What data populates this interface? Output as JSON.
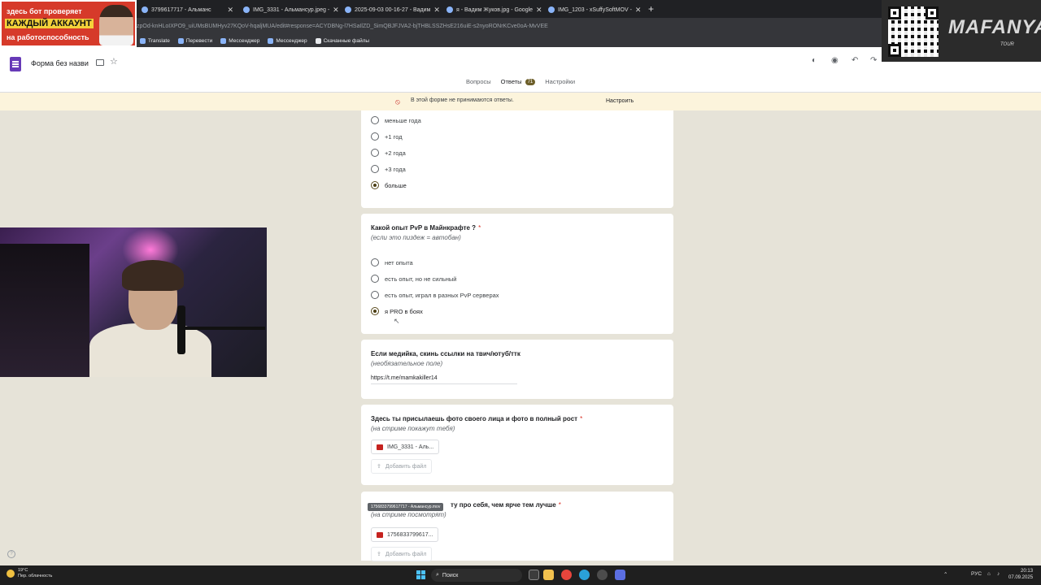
{
  "browser": {
    "tabs": [
      {
        "label": "3799617717 - Альманс"
      },
      {
        "label": "IMG_3331 - Альмансур.jpeg -"
      },
      {
        "label": "2025-09-03 00-16-27 - Вадим"
      },
      {
        "label": "я - Вадим Жуков.jpg - Google"
      },
      {
        "label": "IMG_1203 - xSuffySoftMOV -"
      }
    ],
    "new_tab": "+",
    "url": "zpOd-knHLoIXPO9_uiUMsBUMHyv27KQoV-hqaljMUA/edit#response=ACYDBNg-l7HSaIlZD_SimQBJFJVA2-bjTHBLSSZHsE216uiE-s2nyoRONrKCve0oA-MvVEE",
    "bookmarks": [
      "Translate",
      "Перевести",
      "Мессенджер",
      "Мессенджер",
      "Скачанные файлы"
    ]
  },
  "forms": {
    "title": "Форма без назви",
    "tabs": [
      {
        "label": "Вопросы"
      },
      {
        "label": "Ответы",
        "badge": "71"
      },
      {
        "label": "Настройки"
      }
    ],
    "banner_text": "В этой форме не принимаются ответы.",
    "banner_button": "Настроить"
  },
  "questions": {
    "q1": {
      "options": [
        "меньше года",
        "+1 год",
        "+2 года",
        "+3 года",
        "больше"
      ],
      "selected": 4
    },
    "q2": {
      "title": "Какой опыт PvP в Майнкрафте ?",
      "required": "*",
      "desc": "(если это пиздеж = автобан)",
      "options": [
        "нет опыта",
        "есть опыт, но не сильный",
        "есть опыт, играл в разных PvP серверах",
        "я PRO в боях"
      ],
      "selected": 3
    },
    "q3": {
      "title": "Если медийка, скинь ссылки на твич/ютуб/ттк",
      "desc": "(необязательное поле)",
      "answer": "https://t.me/mamkakiller14"
    },
    "q4": {
      "title": "Здесь ты присылаешь фото своего лица и фото в полный рост",
      "required": "*",
      "desc": "(на стриме покажут тебя)",
      "file": "IMG_3331 - Аль...",
      "add_file": "Добавить файл"
    },
    "q5": {
      "title": "ту про себя, чем ярче тем лучше",
      "required": "*",
      "desc": "(на стриме посмотрят)",
      "tooltip": "1756833799617717 - Альмансур.mov",
      "file": "1756833799617...",
      "add_file": "Добавить файл"
    }
  },
  "overlays": {
    "promo": {
      "line1": "здесь бот проверяет",
      "line2": "КАЖДЫЙ АККАУНТ",
      "line3": "на работоспособность"
    },
    "brand": {
      "name": "MAFANYA",
      "sub": "TOUR"
    }
  },
  "taskbar": {
    "weather_temp": "19°C",
    "weather_desc": "Пер. облачность",
    "search": "Поиск",
    "lang": "РУС",
    "time": "20:13",
    "date": "07.09.2025"
  }
}
